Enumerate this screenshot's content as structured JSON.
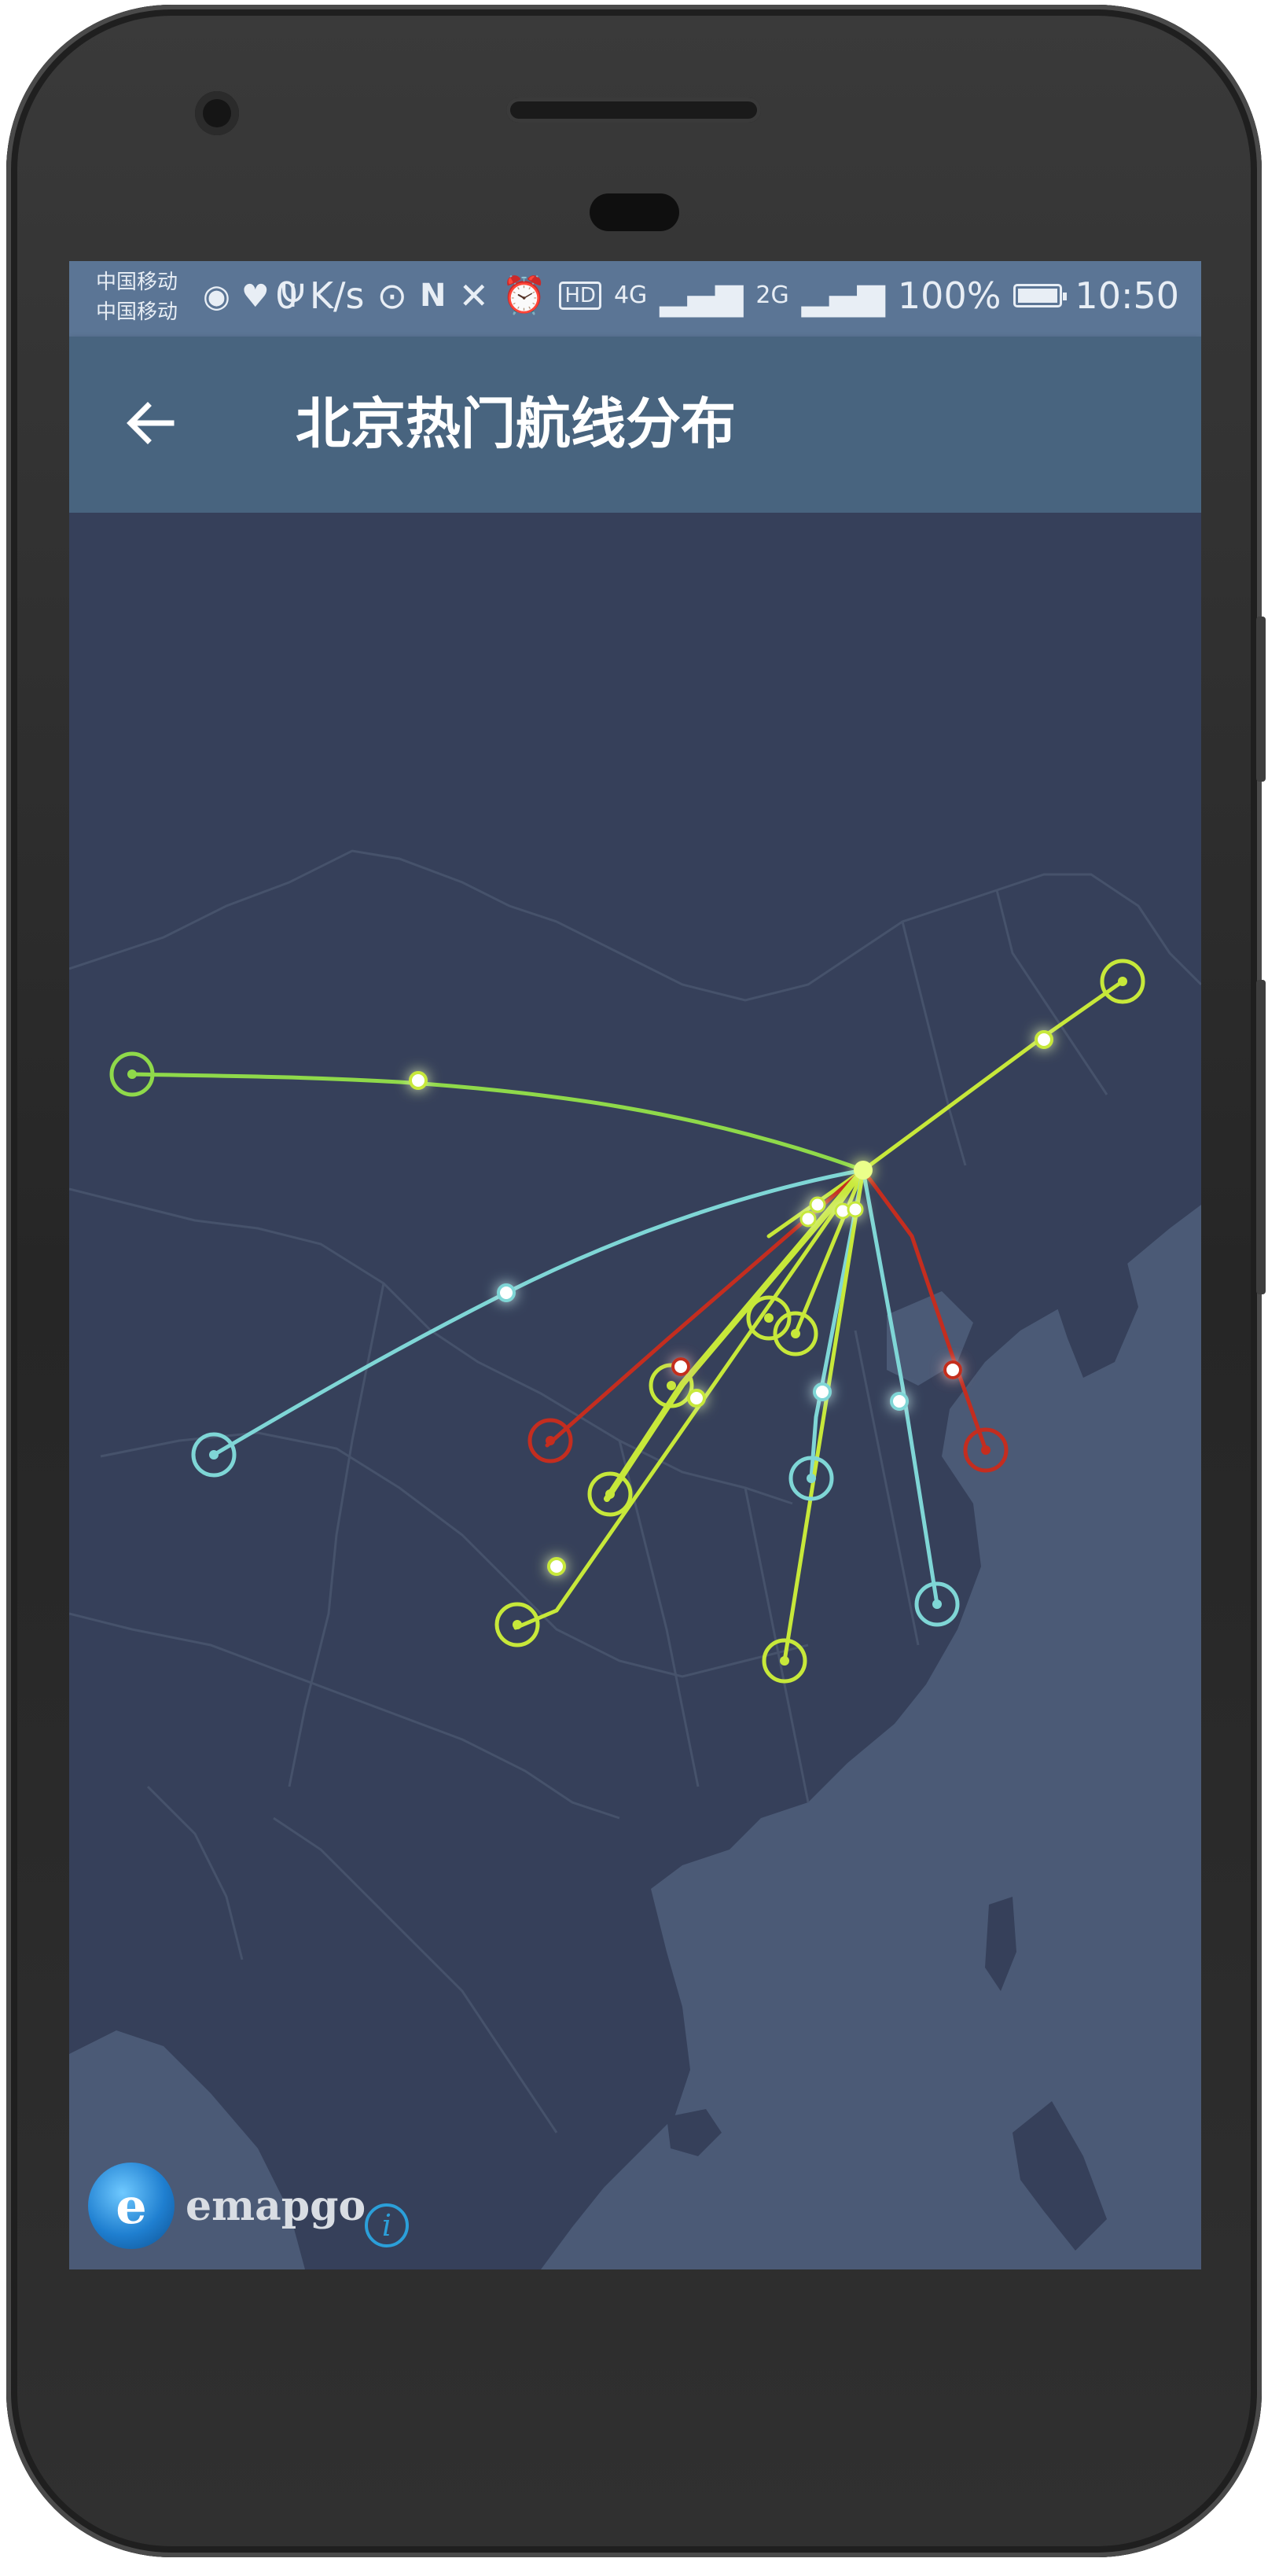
{
  "statusbar": {
    "carrier1": "中国移动",
    "carrier2": "中国移动",
    "net_speed": "0 K/s",
    "net1": "4G",
    "net2": "2G",
    "battery": "100%",
    "time": "10:50"
  },
  "appbar": {
    "title": "北京热门航线分布",
    "back_icon": "arrow-left-icon"
  },
  "map": {
    "hub": "Beijing",
    "route_colors": {
      "green": "#8fd94a",
      "lime": "#c7e83a",
      "cyan": "#7fd6d6",
      "red": "#c42d1f"
    }
  },
  "brand": {
    "logo_text": "emapgo",
    "info_icon": "info-icon"
  }
}
